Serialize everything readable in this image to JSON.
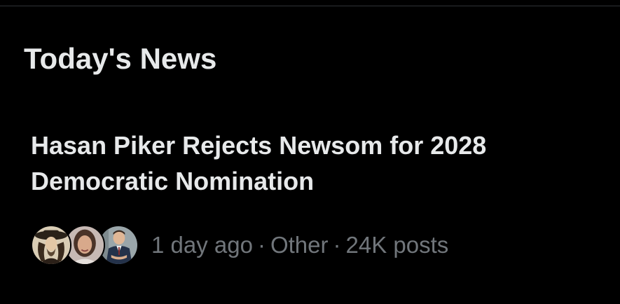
{
  "section": {
    "title": "Today's News"
  },
  "news_item": {
    "headline": "Hasan Piker Rejects Newsom for 2028 Democratic Nomination",
    "time": "1 day ago",
    "separator": "·",
    "category": "Other",
    "posts": "24K posts",
    "avatars": [
      "avatar-1",
      "avatar-2",
      "avatar-3"
    ]
  },
  "colors": {
    "background": "#000000",
    "primary_text": "#e7e9ea",
    "secondary_text": "#71767b",
    "divider": "#2f3336"
  }
}
